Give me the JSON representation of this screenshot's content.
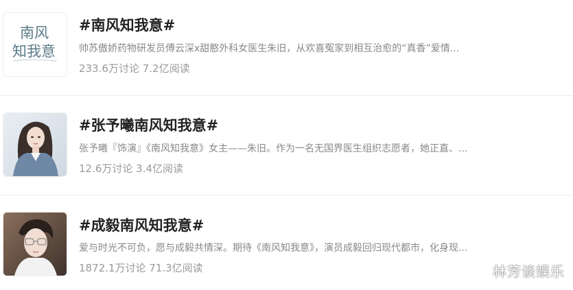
{
  "topics": [
    {
      "title": "#南风知我意#",
      "description": "帅苏傲娇药物研发员傅云深x甜憨外科女医生朱旧，从欢喜冤家到相互治愈的“真香”爱情...",
      "stats": "233.6万讨论 7.2亿阅读",
      "thumbnail": "logo-image",
      "thumbnail_logo_text_line1": "南风",
      "thumbnail_logo_text_line2": "知我意"
    },
    {
      "title": "#张予曦南风知我意#",
      "description": "张予曦『饰演』《南风知我意》女主——朱旧。作为一名无国界医生组织志愿者，她正直、...",
      "stats": "12.6万讨论 3.4亿阅读",
      "thumbnail": "actress-photo"
    },
    {
      "title": "#成毅南风知我意#",
      "description": "爱与时光不可负，愿与成毅共情深。期待《南风知我意》，演员成毅回归现代都市，化身现...",
      "stats": "1872.1万讨论 71.3亿阅读",
      "thumbnail": "actor-photo"
    }
  ],
  "watermark": "林芳谈娱乐",
  "colors": {
    "title": "#222222",
    "description": "#888888",
    "stats": "#999999",
    "logo_ink": "#5a7a86",
    "divider": "#ededed"
  }
}
